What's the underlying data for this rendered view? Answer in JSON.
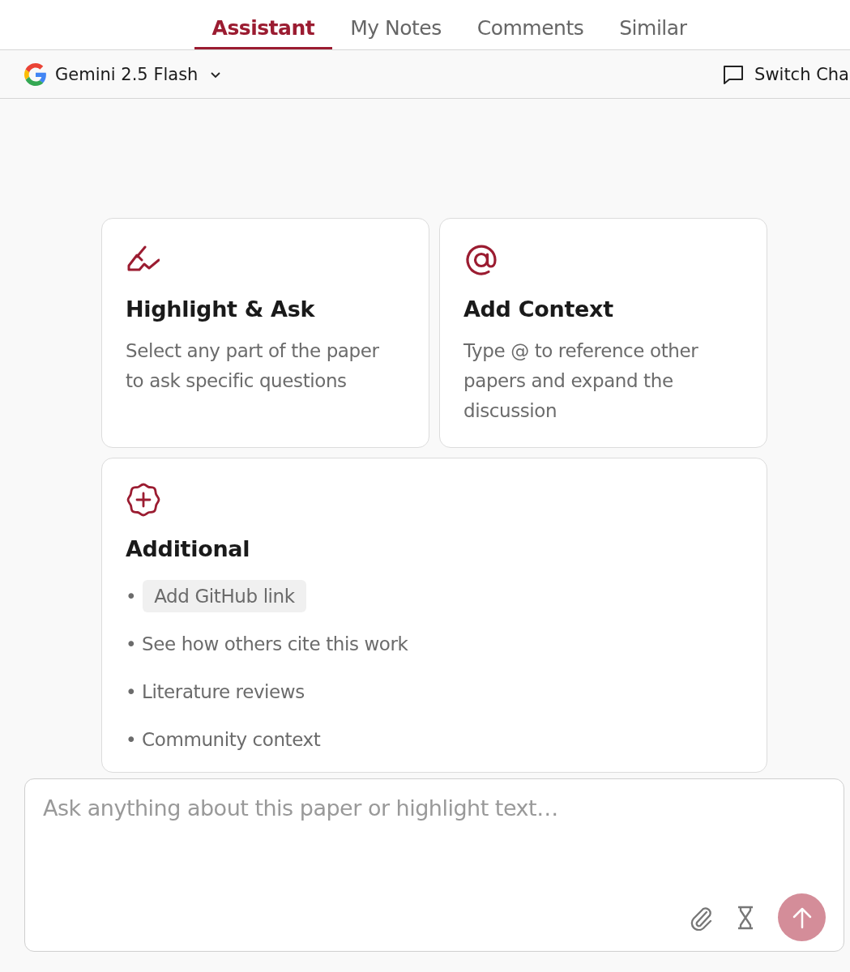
{
  "tabs": [
    {
      "label": "Assistant",
      "selected": true
    },
    {
      "label": "My Notes",
      "selected": false
    },
    {
      "label": "Comments",
      "selected": false
    },
    {
      "label": "Similar",
      "selected": false
    }
  ],
  "model_bar": {
    "model": "Gemini 2.5 Flash",
    "switch_chat": "Switch Cha"
  },
  "cards": [
    {
      "kind": "highlight",
      "title": "Highlight & Ask",
      "description": "Select any part of the paper to ask specific questions"
    },
    {
      "kind": "context",
      "title": "Add Context",
      "description": "Type @ to reference other papers and expand the discussion"
    },
    {
      "kind": "additional",
      "title": "Additional",
      "items": [
        {
          "kind": "chip",
          "bullet": "•",
          "text": "Add GitHub link"
        },
        {
          "kind": "plain",
          "text": "• See how others cite this work"
        },
        {
          "kind": "plain",
          "text": "• Literature reviews"
        },
        {
          "kind": "plain",
          "text": "• Community context"
        }
      ]
    }
  ],
  "chat_input": {
    "placeholder": "Ask anything about this paper or highlight text…",
    "send_disabled": true
  }
}
